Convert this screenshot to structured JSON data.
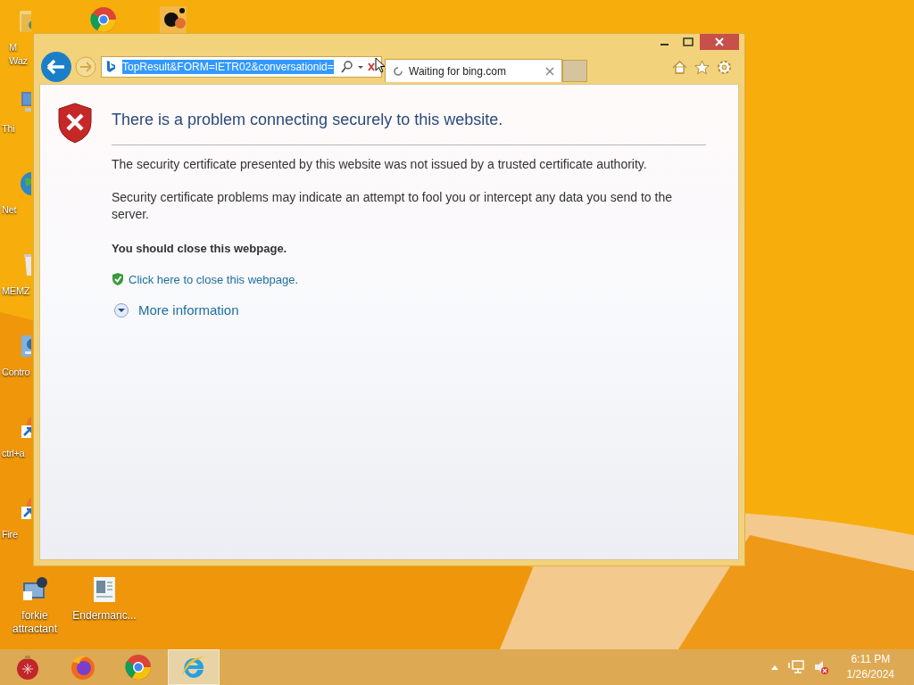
{
  "desktop_icons": [
    {
      "kind": "folder",
      "lines": [
        "M",
        "Waz"
      ]
    },
    {
      "kind": "pc",
      "lines": [
        "Thi"
      ]
    },
    {
      "kind": "globe",
      "lines": [
        "Net"
      ]
    },
    {
      "kind": "bin",
      "lines": [
        "MEMZ"
      ]
    },
    {
      "kind": "control",
      "lines": [
        "Contro"
      ]
    },
    {
      "kind": "shortcut",
      "lines": [
        "ctrl+a"
      ]
    },
    {
      "kind": "shortcut",
      "lines": [
        "Fire"
      ]
    }
  ],
  "top_icons": [
    {
      "kind": "chrome"
    },
    {
      "kind": "app"
    }
  ],
  "bottom_icons": [
    {
      "kind": "tool",
      "lines": [
        "forkie",
        "attractant"
      ]
    },
    {
      "kind": "doc",
      "lines": [
        "Endermanc..."
      ]
    }
  ],
  "browser": {
    "address": "TopResult&FORM=IETR02&conversationid=",
    "tabs": [
      {
        "label": "Waiting for bing.com",
        "loading": true,
        "selected": true
      }
    ],
    "page": {
      "heading": "There is a problem connecting securely to this website.",
      "paragraphs": [
        "The security certificate presented by this website was not issued by a trusted certificate authority.",
        "Security certificate problems may indicate an attempt to fool you or intercept any data you send to the server."
      ],
      "recommendation": "You should close this webpage.",
      "close_link": "Click here to close this webpage.",
      "more_info": {
        "label": "More information",
        "expanded": false
      }
    }
  },
  "taskbar": {
    "apps": [
      {
        "kind": "ornament",
        "selected": false
      },
      {
        "kind": "firefox",
        "selected": false
      },
      {
        "kind": "chrome",
        "selected": false
      },
      {
        "kind": "ie",
        "selected": true
      }
    ],
    "time": "6:11 PM",
    "date": "1/26/2024"
  }
}
